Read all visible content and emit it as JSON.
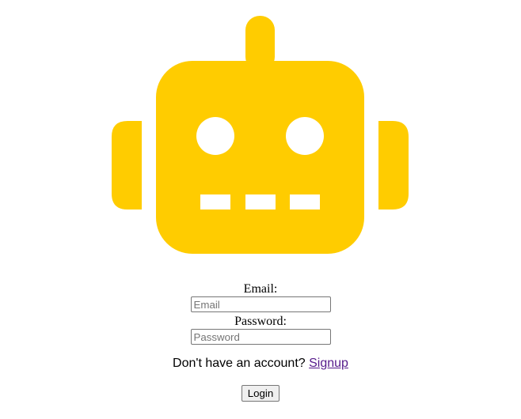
{
  "logo": {
    "icon": "robot-icon",
    "color": "#ffcc00"
  },
  "form": {
    "email_label": "Email:",
    "email_placeholder": "Email",
    "email_value": "",
    "password_label": "Password:",
    "password_placeholder": "Password",
    "password_value": ""
  },
  "signup": {
    "prompt": "Don't have an account?",
    "link_label": "Signup"
  },
  "login": {
    "button_label": "Login"
  }
}
